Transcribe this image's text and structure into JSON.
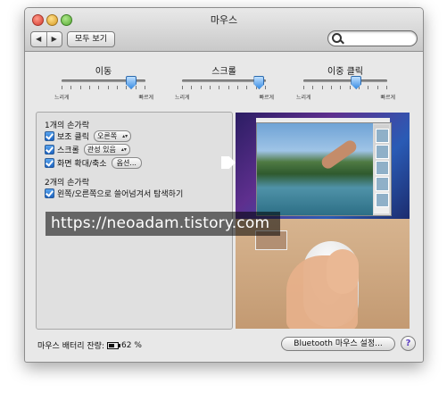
{
  "window": {
    "title": "마우스",
    "show_all": "모두 보기",
    "back_glyph": "◀",
    "forward_glyph": "▶",
    "search_placeholder": ""
  },
  "sliders": [
    {
      "label": "이동",
      "slow": "느리게",
      "fast": "빠르게",
      "level": 0.83
    },
    {
      "label": "스크롤",
      "slow": "느리게",
      "fast": "빠르게",
      "level": 0.92
    },
    {
      "label": "이중 클릭",
      "slow": "느리게",
      "fast": "빠르게",
      "level": 0.63
    }
  ],
  "one_finger": {
    "heading": "1개의 손가락",
    "secondary_click": {
      "label": "보조 클릭",
      "value": "오른쪽",
      "checked": true
    },
    "scroll": {
      "label": "스크롤",
      "value": "관성 있음",
      "checked": true
    },
    "zoom": {
      "label": "화면 확대/축소",
      "button": "옵션...",
      "checked": true
    }
  },
  "two_finger": {
    "heading": "2개의 손가락",
    "swipe": {
      "label": "왼쪽/오른쪽으로 쓸어넘겨서 탐색하기",
      "checked": true
    }
  },
  "watermark": "https://neoadam.tistory.com",
  "footer": {
    "battery_label": "마우스 배터리 잔량:",
    "battery_value": "62 %",
    "bluetooth_button": "Bluetooth 마우스 설정...",
    "help": "?"
  }
}
